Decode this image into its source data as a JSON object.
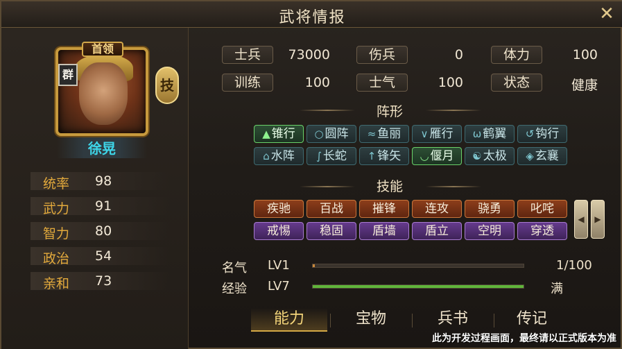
{
  "window": {
    "title": "武将情报"
  },
  "hero": {
    "leader_tag": "首领",
    "faction": "群",
    "skill_tag": "技",
    "name": "徐晃",
    "attributes": [
      {
        "label": "统率",
        "value": "98"
      },
      {
        "label": "武力",
        "value": "91"
      },
      {
        "label": "智力",
        "value": "80"
      },
      {
        "label": "政治",
        "value": "54"
      },
      {
        "label": "亲和",
        "value": "73"
      }
    ]
  },
  "stats": [
    {
      "label": "士兵",
      "value": "73000"
    },
    {
      "label": "伤兵",
      "value": "0"
    },
    {
      "label": "体力",
      "value": "100"
    },
    {
      "label": "训练",
      "value": "100"
    },
    {
      "label": "士气",
      "value": "100"
    },
    {
      "label": "状态",
      "value": "健康"
    }
  ],
  "formation": {
    "title": "阵形",
    "items": [
      {
        "label": "锥行",
        "icon": "▲",
        "active": true
      },
      {
        "label": "圆阵",
        "icon": "○",
        "active": false
      },
      {
        "label": "鱼丽",
        "icon": "≈",
        "active": false
      },
      {
        "label": "雁行",
        "icon": "∨",
        "active": false
      },
      {
        "label": "鹤翼",
        "icon": "ω",
        "active": false
      },
      {
        "label": "钩行",
        "icon": "↺",
        "active": false
      },
      {
        "label": "水阵",
        "icon": "⌂",
        "active": false
      },
      {
        "label": "长蛇",
        "icon": "∫",
        "active": false
      },
      {
        "label": "锋矢",
        "icon": "↑",
        "active": false
      },
      {
        "label": "偃月",
        "icon": "◡",
        "active": true
      },
      {
        "label": "太极",
        "icon": "☯",
        "active": false
      },
      {
        "label": "玄襄",
        "icon": "◈",
        "active": false
      }
    ]
  },
  "skills": {
    "title": "技能",
    "items": [
      {
        "label": "疾驰",
        "color": "orange"
      },
      {
        "label": "百战",
        "color": "orange"
      },
      {
        "label": "摧锋",
        "color": "orange"
      },
      {
        "label": "连攻",
        "color": "orange"
      },
      {
        "label": "骁勇",
        "color": "orange"
      },
      {
        "label": "叱咤",
        "color": "orange"
      },
      {
        "label": "戒惕",
        "color": "purple"
      },
      {
        "label": "稳固",
        "color": "purple"
      },
      {
        "label": "盾墙",
        "color": "purple"
      },
      {
        "label": "盾立",
        "color": "purple"
      },
      {
        "label": "空明",
        "color": "purple"
      },
      {
        "label": "穿透",
        "color": "purple"
      }
    ]
  },
  "progress": {
    "fame": {
      "label": "名气",
      "level": "LV1",
      "text": "1/100",
      "fraction": 0.01,
      "color": "#c9873a"
    },
    "exp": {
      "label": "经验",
      "level": "LV7",
      "text": "满",
      "fraction": 1.0,
      "color": "#5fb53a"
    }
  },
  "tabs": [
    {
      "label": "能力",
      "active": true
    },
    {
      "label": "宝物",
      "active": false
    },
    {
      "label": "兵书",
      "active": false
    },
    {
      "label": "传记",
      "active": false
    }
  ],
  "footer_note": "此为开发过程画面，最终请以正式版本为准"
}
